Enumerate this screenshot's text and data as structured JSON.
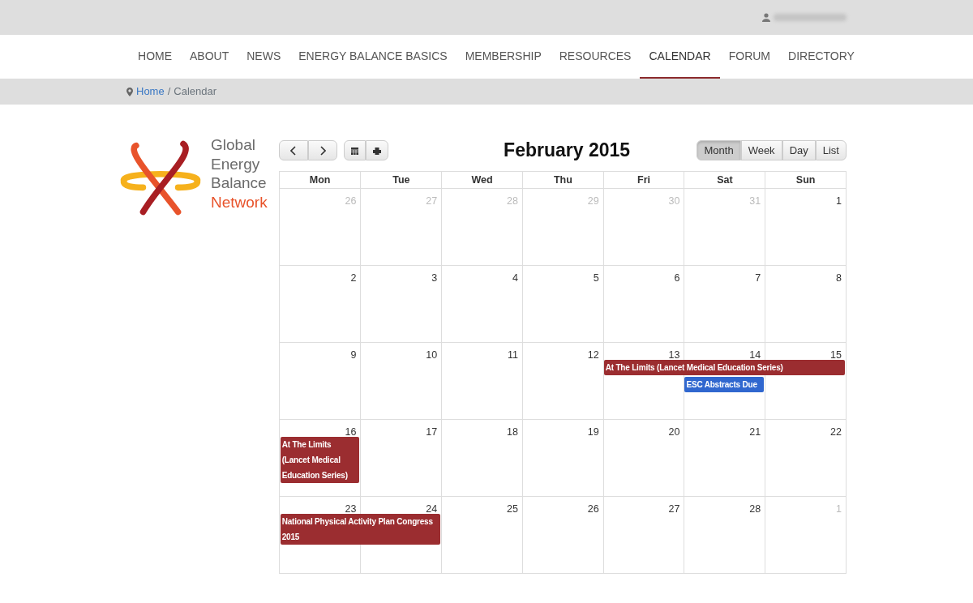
{
  "nav": [
    {
      "label": "HOME",
      "selected": false
    },
    {
      "label": "ABOUT",
      "selected": false
    },
    {
      "label": "NEWS",
      "selected": false
    },
    {
      "label": "ENERGY BALANCE BASICS",
      "selected": false
    },
    {
      "label": "MEMBERSHIP",
      "selected": false
    },
    {
      "label": "RESOURCES",
      "selected": false
    },
    {
      "label": "CALENDAR",
      "selected": true
    },
    {
      "label": "FORUM",
      "selected": false
    },
    {
      "label": "DIRECTORY",
      "selected": false
    }
  ],
  "breadcrumb": {
    "link": "Home",
    "separator": "/",
    "current": "Calendar"
  },
  "logo": {
    "lines": [
      "Global",
      "Energy",
      "Balance"
    ],
    "accent": "Network"
  },
  "calendar": {
    "title": "February 2015",
    "views": [
      {
        "label": "Month",
        "selected": true
      },
      {
        "label": "Week",
        "selected": false
      },
      {
        "label": "Day",
        "selected": false
      },
      {
        "label": "List",
        "selected": false
      }
    ],
    "weekdays": [
      "Mon",
      "Tue",
      "Wed",
      "Thu",
      "Fri",
      "Sat",
      "Sun"
    ],
    "weeks": [
      {
        "days": [
          {
            "day": "26",
            "other_month": true
          },
          {
            "day": "27",
            "other_month": true
          },
          {
            "day": "28",
            "other_month": true
          },
          {
            "day": "29",
            "other_month": true
          },
          {
            "day": "30",
            "other_month": true
          },
          {
            "day": "31",
            "other_month": true
          },
          {
            "day": "1",
            "other_month": false
          }
        ]
      },
      {
        "days": [
          {
            "day": "2",
            "other_month": false
          },
          {
            "day": "3",
            "other_month": false
          },
          {
            "day": "4",
            "other_month": false
          },
          {
            "day": "5",
            "other_month": false
          },
          {
            "day": "6",
            "other_month": false
          },
          {
            "day": "7",
            "other_month": false
          },
          {
            "day": "8",
            "other_month": false
          }
        ]
      },
      {
        "days": [
          {
            "day": "9",
            "other_month": false
          },
          {
            "day": "10",
            "other_month": false
          },
          {
            "day": "11",
            "other_month": false
          },
          {
            "day": "12",
            "other_month": false
          },
          {
            "day": "13",
            "other_month": false,
            "events": [
              {
                "title": "At The Limits (Lancet Medical Education Series)",
                "color": "#9b2d30"
              }
            ]
          },
          {
            "day": "14",
            "other_month": false,
            "continued": true,
            "events": [
              {
                "title": "ESC Abstracts Due",
                "color": "#3067cf"
              }
            ]
          },
          {
            "day": "15",
            "other_month": false,
            "continued": true
          }
        ]
      },
      {
        "days": [
          {
            "day": "16",
            "other_month": false,
            "events": [
              {
                "title": "At The Limits (Lancet Medical Education Series)",
                "color": "#9b2d30"
              }
            ]
          },
          {
            "day": "17",
            "other_month": false
          },
          {
            "day": "18",
            "other_month": false
          },
          {
            "day": "19",
            "other_month": false
          },
          {
            "day": "20",
            "other_month": false
          },
          {
            "day": "21",
            "other_month": false
          },
          {
            "day": "22",
            "other_month": false
          }
        ]
      },
      {
        "days": [
          {
            "day": "23",
            "other_month": false,
            "events": [
              {
                "title": "National Physical Activity Plan Congress 2015",
                "color": "#9b2d30"
              }
            ]
          },
          {
            "day": "24",
            "other_month": false,
            "continued": true
          },
          {
            "day": "25",
            "other_month": false
          },
          {
            "day": "26",
            "other_month": false
          },
          {
            "day": "27",
            "other_month": false
          },
          {
            "day": "28",
            "other_month": false
          },
          {
            "day": "1",
            "other_month": true
          }
        ]
      }
    ]
  }
}
